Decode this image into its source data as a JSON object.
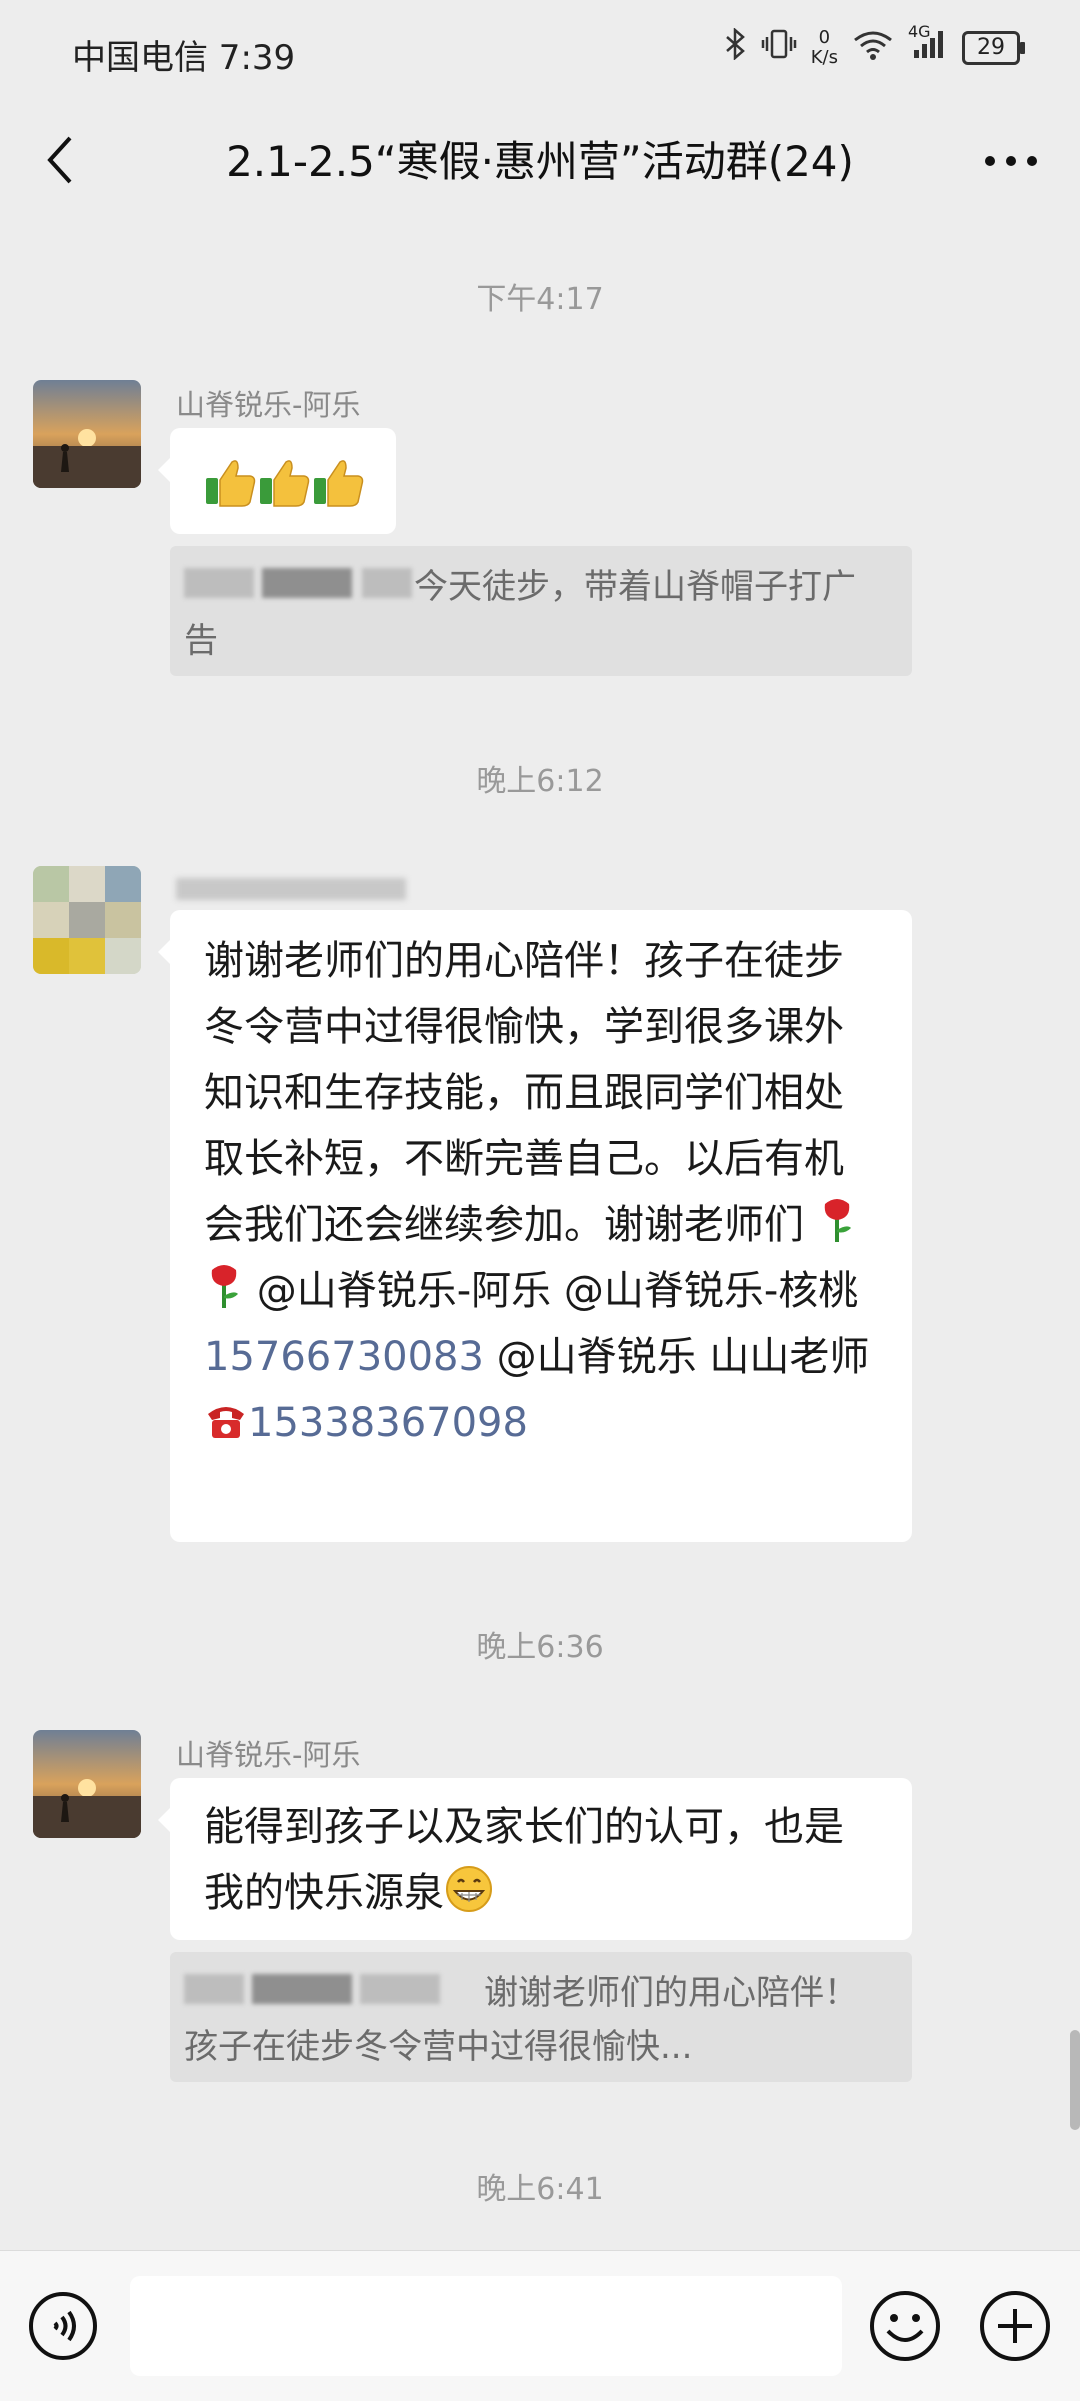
{
  "status_bar": {
    "carrier": "中国电信 7:39",
    "net_speed_value": "0",
    "net_speed_unit": "K/s",
    "network_type": "4G",
    "battery": "29"
  },
  "header": {
    "title": "2.1-2.5“寒假·惠州营”活动群(24)"
  },
  "messages": {
    "t1": "下午4:17",
    "m1_sender": "山脊锐乐-阿乐",
    "m1_quote": "今天徒步，带着山脊帽子打广告",
    "t2": "晚上6:12",
    "m2_text_a": "谢谢老师们的用心陪伴！孩子在徒步冬令营中过得很愉快，学到很多课外知识和生存技能，而且跟同学们相处取长补短，不断完善自己。以后有机会我们还会继续参加。谢谢老师们",
    "m2_text_b": "@山脊锐乐-阿乐 @山脊锐乐-核桃",
    "m2_phone1": "15766730083",
    "m2_text_c": " @山脊锐乐 山山老师",
    "m2_phone2": "15338367098",
    "t3": "晚上6:36",
    "m3_sender": "山脊锐乐-阿乐",
    "m3_text": "能得到孩子以及家长们的认可，也是我的快乐源泉",
    "m3_quote": "谢谢老师们的用心陪伴！孩子在徒步冬令营中过得很愉快...",
    "t4": "晚上6:41"
  },
  "input": {
    "placeholder": ""
  }
}
